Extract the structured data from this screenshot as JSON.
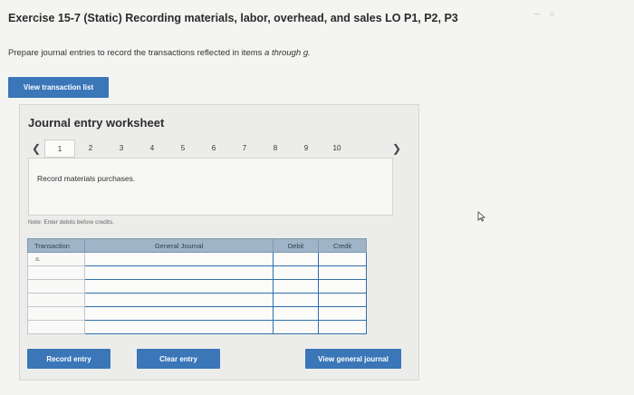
{
  "header": {
    "title": "Exercise 15-7 (Static) Recording materials, labor, overhead, and sales LO P1, P2, P3",
    "instruction_prefix": "Prepare journal entries to record the transactions reflected in items ",
    "instruction_range": "a through g.",
    "view_transaction_label": "View transaction list"
  },
  "worksheet": {
    "title": "Journal entry worksheet",
    "pages": [
      "1",
      "2",
      "3",
      "4",
      "5",
      "6",
      "7",
      "8",
      "9",
      "10"
    ],
    "active_page": "1",
    "description": "Record materials purchases.",
    "note": "Note: Enter debits before credits.",
    "table": {
      "headers": [
        "Transaction",
        "General Journal",
        "Debit",
        "Credit"
      ],
      "rows": [
        {
          "transaction": "a."
        },
        {
          "transaction": ""
        },
        {
          "transaction": ""
        },
        {
          "transaction": ""
        },
        {
          "transaction": ""
        },
        {
          "transaction": ""
        }
      ]
    },
    "buttons": {
      "record": "Record entry",
      "clear": "Clear entry",
      "view_journal": "View general journal"
    }
  },
  "colors": {
    "button_blue": "#3a76b8",
    "table_header": "#9fb4c7",
    "input_border": "#2f6fa8"
  }
}
